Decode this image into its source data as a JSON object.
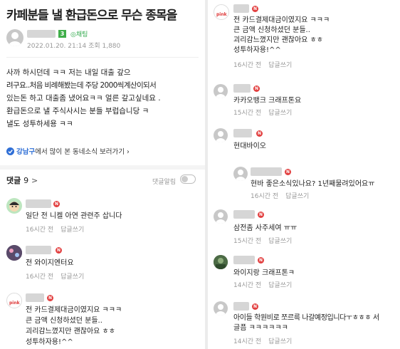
{
  "post": {
    "title": "카페분들 낼 환급돈으로 무슨 종목을",
    "level_badge": "3",
    "trade_tag": "채팅",
    "date": "2022.01.20. 21:14",
    "views_label": "조회 1,880",
    "body_lines": [
      "사까 하시던데 ㅋㅋ 저는 내일 대출 갚으",
      "려구요..처음 비례해봤는데 주당 2000씩계산이되서",
      "있는돈 하고 대출좀 냈어요ㅋㅋ 얼른 갚고싶네요 .",
      "환급돈으로  낼 주식사시는 분들 부럽습니당 ㅋ",
      "낼도 성투하세용 ㅋㅋ"
    ],
    "neighborhood_region": "강남구",
    "neighborhood_suffix": "에서 많이 본 동네소식 보러가기 ›"
  },
  "comments_header": {
    "label": "댓글",
    "count": "9",
    "arrow": ">",
    "notify_label": "댓글알림"
  },
  "left_comments": [
    {
      "text": "일단 전 니켈 아연 관련주 삽니다",
      "time": "16시간 전",
      "reply": "답글쓰기"
    },
    {
      "text": "전 와이지엔터요",
      "time": "16시간 전",
      "reply": "답글쓰기"
    },
    {
      "lines": [
        "전 카드결제대금이였지요 ㅋㅋㅋ",
        "큰 금액 신청하셨던 분들..",
        "괴리감느꼈지만 괜찮아요 ㅎㅎ",
        "성투하자용!^^"
      ],
      "time": "",
      "reply": ""
    }
  ],
  "right_comments": [
    {
      "lines": [
        "전 카드결제대금이였지요 ㅋㅋㅋ",
        "큰 금액 신청하셨던 분들..",
        "괴리감느꼈지만 괜찮아요 ㅎㅎ",
        "성투하자용!^^"
      ],
      "time": "16시간 전",
      "reply": "답글쓰기"
    },
    {
      "text": "카카오뱅크 크래프톤요",
      "time": "15시간 전",
      "reply": "답글쓰기"
    },
    {
      "text": "현대바이오",
      "time": "",
      "reply": ""
    },
    {
      "text": "현바 좋은소식있나요? 1년째물려있어요ㅠ",
      "time": "16시간 전",
      "reply": "답글쓰기"
    },
    {
      "text": "삼전좀 사주세여 ㅠㅠ",
      "time": "15시간 전",
      "reply": "답글쓰기"
    },
    {
      "text": "와이지랑 크래프톤ㅋ",
      "time": "14시간 전",
      "reply": "답글쓰기"
    },
    {
      "lines": [
        "아이들 학원비로 쪼르륵 나갈예정입니다ㅜㅎㅎㅎ 서",
        "글픔 ㅋㅋㅋㅋㅋㅋ"
      ],
      "time": "14시간 전",
      "reply": "답글쓰기"
    }
  ],
  "badges": {
    "n": "N"
  }
}
